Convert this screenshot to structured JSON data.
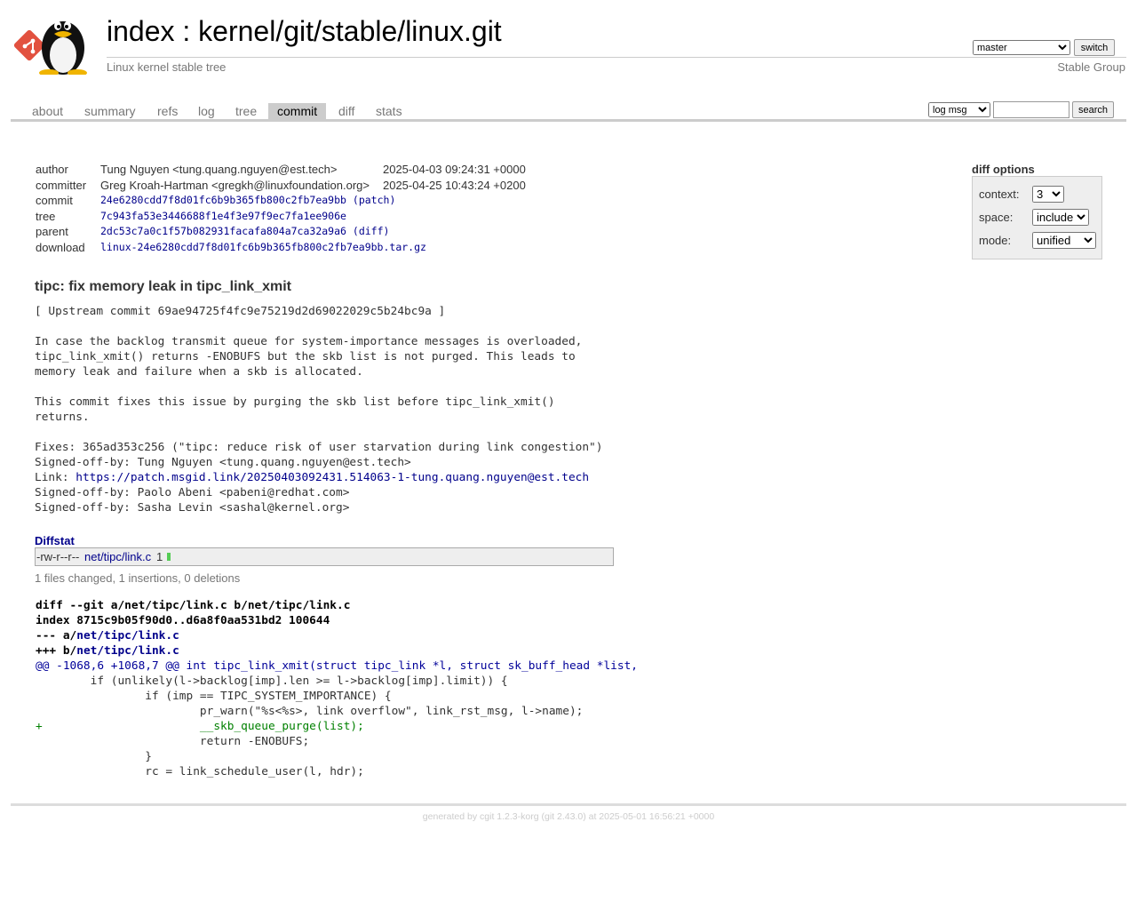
{
  "header": {
    "title_index": "index",
    "title_sep": " : ",
    "title_repo": "kernel/git/stable/linux.git",
    "subtitle": "Linux kernel stable tree",
    "owner": "Stable Group",
    "branch_selected": "master",
    "switch_label": "switch"
  },
  "tabs": [
    {
      "label": "about"
    },
    {
      "label": "summary"
    },
    {
      "label": "refs"
    },
    {
      "label": "log"
    },
    {
      "label": "tree"
    },
    {
      "label": "commit",
      "active": true
    },
    {
      "label": "diff"
    },
    {
      "label": "stats"
    }
  ],
  "search": {
    "scope_selected": "log msg",
    "query": "",
    "button_label": "search"
  },
  "commit_info": {
    "author_label": "author",
    "author": "Tung Nguyen <tung.quang.nguyen@est.tech>",
    "author_date": "2025-04-03 09:24:31 +0000",
    "committer_label": "committer",
    "committer": "Greg Kroah-Hartman <gregkh@linuxfoundation.org>",
    "committer_date": "2025-04-25 10:43:24 +0200",
    "commit_label": "commit",
    "commit": "24e6280cdd7f8d01fc6b9b365fb800c2fb7ea9bb",
    "commit_patch": "patch",
    "tree_label": "tree",
    "tree": "7c943fa53e3446688f1e4f3e97f9ec7fa1ee906e",
    "parent_label": "parent",
    "parent": "2dc53c7a0c1f57b082931facafa804a7ca32a9a6",
    "parent_diff": "diff",
    "download_label": "download",
    "download": "linux-24e6280cdd7f8d01fc6b9b365fb800c2fb7ea9bb.tar.gz"
  },
  "diff_options": {
    "title": "diff options",
    "context_label": "context:",
    "context_value": "3",
    "space_label": "space:",
    "space_value": "include",
    "mode_label": "mode:",
    "mode_value": "unified"
  },
  "subject": "tipc: fix memory leak in tipc_link_xmit",
  "message": {
    "upstream": "[ Upstream commit 69ae94725f4fc9e75219d2d69022029c5b24bc9a ]",
    "p1": "In case the backlog transmit queue for system-importance messages is overloaded,\ntipc_link_xmit() returns -ENOBUFS but the skb list is not purged. This leads to\nmemory leak and failure when a skb is allocated.",
    "p2": "This commit fixes this issue by purging the skb list before tipc_link_xmit()\nreturns.",
    "fixes": "Fixes: 365ad353c256 (\"tipc: reduce risk of user starvation during link congestion\")",
    "sob1": "Signed-off-by: Tung Nguyen <tung.quang.nguyen@est.tech>",
    "link_label": "Link: ",
    "link_url": "https://patch.msgid.link/20250403092431.514063-1-tung.quang.nguyen@est.tech",
    "sob2": "Signed-off-by: Paolo Abeni <pabeni@redhat.com>",
    "sob3": "Signed-off-by: Sasha Levin <sashal@kernel.org>"
  },
  "diffstat": {
    "heading": "Diffstat",
    "mode": "-rw-r--r--",
    "file": "net/tipc/link.c",
    "count": "1",
    "insertions_fraction": 1.0,
    "summary": "1 files changed, 1 insertions, 0 deletions"
  },
  "diff": {
    "line1": "diff --git a/net/tipc/link.c b/net/tipc/link.c",
    "line2": "index 8715c9b05f90d0..d6a8f0aa531bd2 100644",
    "minus_prefix": "--- a/",
    "plus_prefix": "+++ b/",
    "file": "net/tipc/link.c",
    "hunk": "@@ -1068,6 +1068,7 @@ int tipc_link_xmit(struct tipc_link *l, struct sk_buff_head *list,",
    "c1": "\tif (unlikely(l->backlog[imp].len >= l->backlog[imp].limit)) {",
    "c2": "\t\tif (imp == TIPC_SYSTEM_IMPORTANCE) {",
    "c3": "\t\t\tpr_warn(\"%s<%s>, link overflow\", link_rst_msg, l->name);",
    "add1": "+\t\t\t__skb_queue_purge(list);",
    "c4": "\t\t\treturn -ENOBUFS;",
    "c5": "\t\t}",
    "c6": "\t\trc = link_schedule_user(l, hdr);"
  },
  "footer": {
    "generated_by": "generated by ",
    "cgit": "cgit 1.2.3-korg",
    "git_open": " (",
    "git": "git 2.43.0",
    "rest": ") at 2025-05-01 16:56:21 +0000"
  }
}
